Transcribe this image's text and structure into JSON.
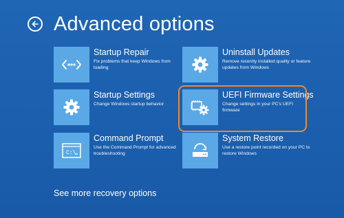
{
  "header": {
    "title": "Advanced options"
  },
  "tiles": [
    {
      "title": "Startup Repair",
      "description": "Fix problems that keep Windows from loading",
      "icon": "code-brackets-icon"
    },
    {
      "title": "Uninstall Updates",
      "description": "Remove recently installed quality or feature updates from Windows",
      "icon": "gear-icon"
    },
    {
      "title": "Startup Settings",
      "description": "Change Windows startup behavior",
      "icon": "gear-icon"
    },
    {
      "title": "UEFI Firmware Settings",
      "description": "Change settings in your PC's UEFI firmware",
      "icon": "firmware-gear-icon",
      "selected": true
    },
    {
      "title": "Command Prompt",
      "description": "Use the Command Prompt for advanced troubleshooting",
      "icon": "command-prompt-icon"
    },
    {
      "title": "System Restore",
      "description": "Use a restore point recorded on your PC to restore Windows",
      "icon": "system-restore-icon"
    }
  ],
  "footer": {
    "more_link": "See more recovery options"
  },
  "colors": {
    "background": "#1b5fae",
    "tile_icon_bg": "#5aa9e6",
    "selection_outline": "#f08a2a"
  }
}
